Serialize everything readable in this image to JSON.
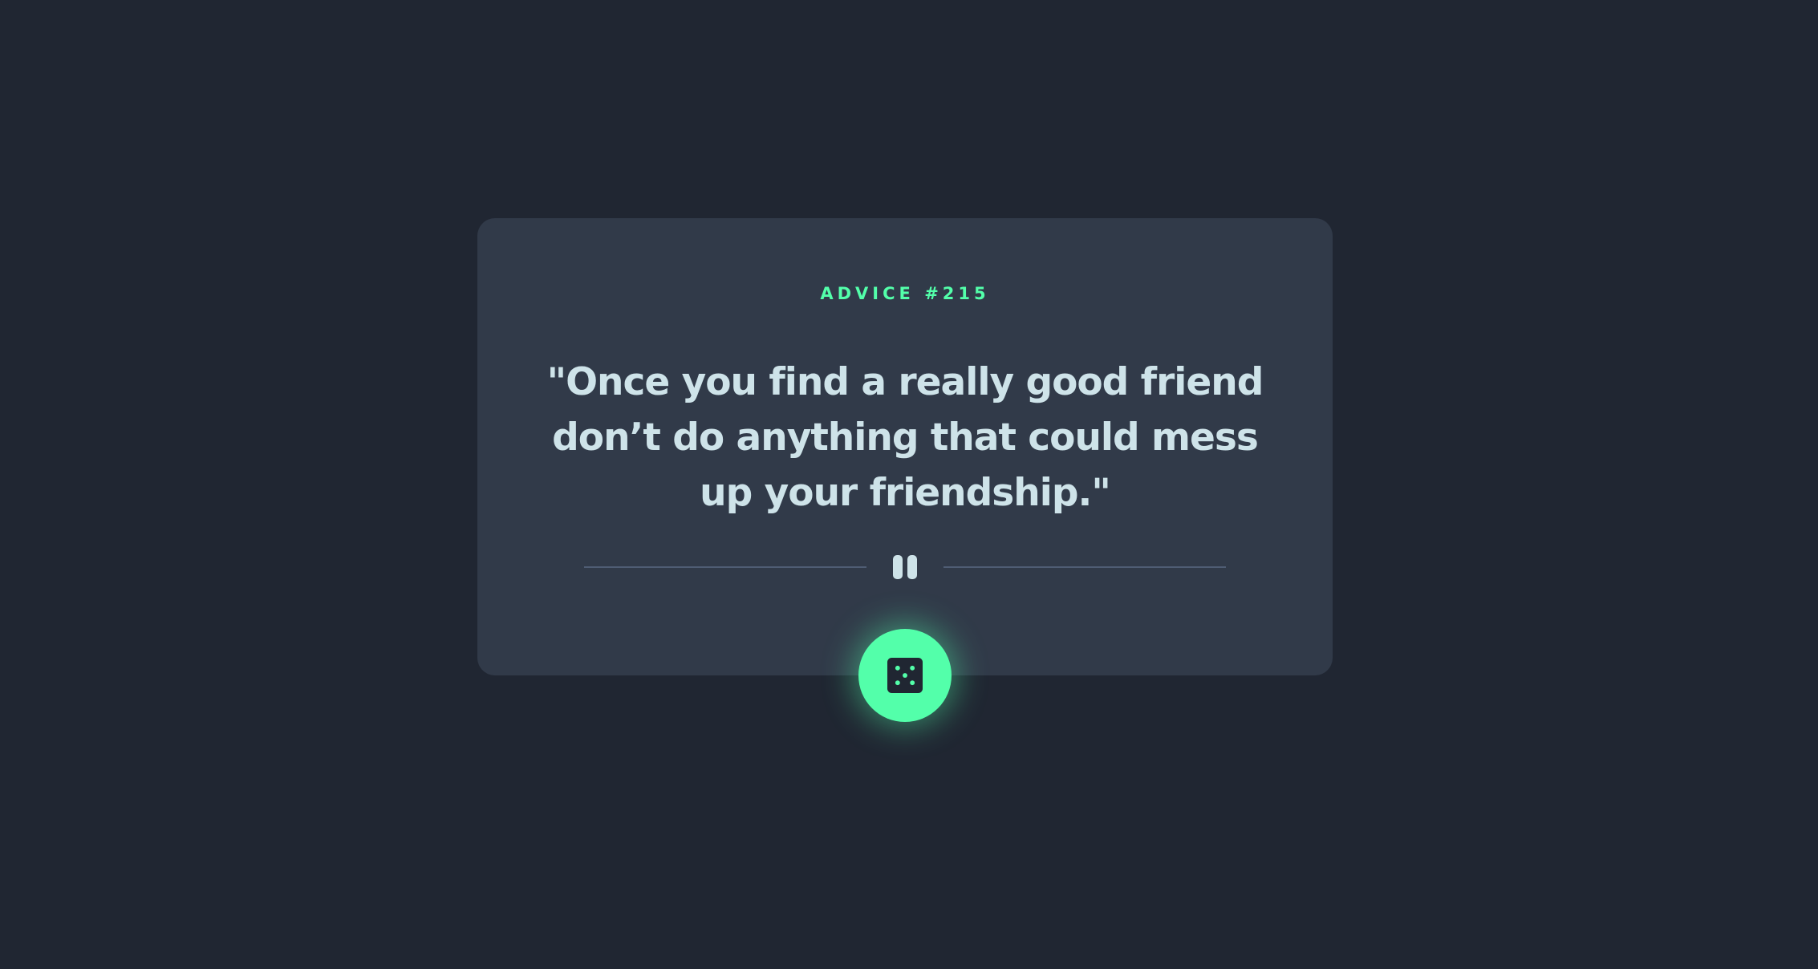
{
  "card": {
    "advice_label": "ADVICE #215",
    "quote": "\"Once you find a really good friend don’t do anything that could mess up your friendship.\""
  },
  "icons": {
    "divider_icon": "pause-icon",
    "button_icon": "dice-icon"
  },
  "colors": {
    "background": "#202632",
    "card": "#313a49",
    "accent": "#53ffaa",
    "text": "#cee3e9",
    "divider": "#4f5d74"
  }
}
